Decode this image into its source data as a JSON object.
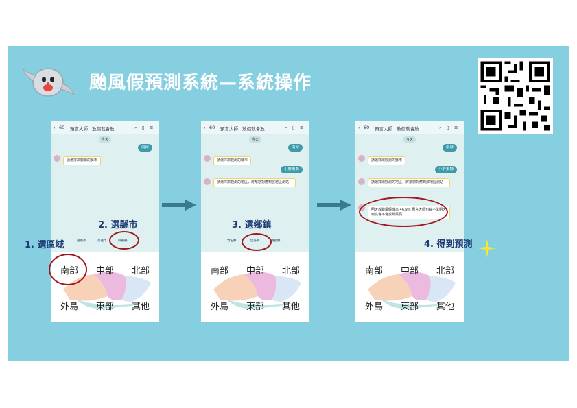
{
  "header": {
    "title": "颱風假預測系統—系統操作"
  },
  "qr_code": {
    "icon": "qr-code-icon"
  },
  "phone": {
    "back_count": "60",
    "chat_title": "預言大師...放假就會放",
    "date_badge": "今天",
    "prompt_city": "請選擇欲觀測的縣市",
    "prompt_town": "請選擇欲觀測的地區，將幫您對應到該地區測站",
    "reply_region": "南部",
    "reply_city": "小屏東縣",
    "result_text": "明天放颱風假機率:46.9% 預言大師也算不準明天到底會不會放颱風假...",
    "menu_regions": [
      "南部",
      "中部",
      "北部",
      "外島",
      "東部",
      "其他"
    ],
    "tabs_step1": [
      "臺南市",
      "高雄市",
      "屏東縣"
    ],
    "tabs_step2": [
      "竹田鄉",
      "佳冬鄉",
      "枋寮鄉"
    ]
  },
  "steps": {
    "step1": "1. 選區域",
    "step2": "2. 選縣市",
    "step3": "3. 選鄉鎮",
    "step4": "4. 得到預測"
  },
  "colors": {
    "background": "#86cfe0",
    "highlight": "#a1171f",
    "step_text": "#1f3c77",
    "arrow": "#3a7a8e"
  }
}
